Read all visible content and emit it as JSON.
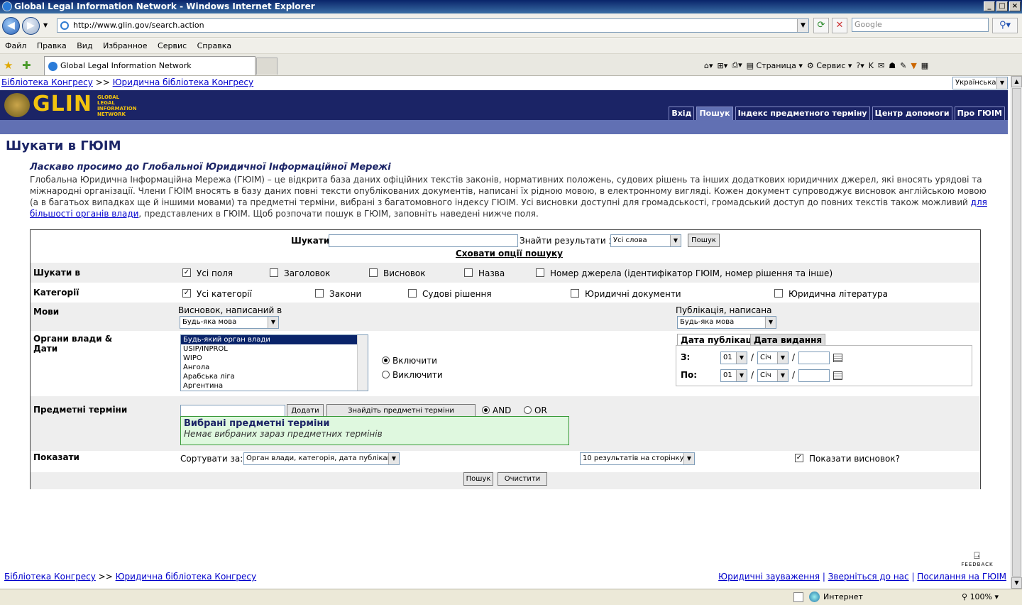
{
  "window": {
    "title": "Global Legal Information Network - Windows Internet Explorer"
  },
  "browser": {
    "url": "http://www.glin.gov/search.action",
    "search_placeholder": "Google",
    "menu": [
      "Файл",
      "Правка",
      "Вид",
      "Избранное",
      "Сервис",
      "Справка"
    ],
    "tab_title": "Global Legal Information Network",
    "cmd_page": "Страница",
    "cmd_tools": "Сервис",
    "status_zone": "Интернет",
    "zoom": "100%"
  },
  "page": {
    "breadcrumb": {
      "item1": "Бібліотека Конгресу",
      "sep": ">>",
      "item2": "Юридична бібліотека Конгресу"
    },
    "language_select": "Українська",
    "logo": {
      "text": "GLIN",
      "sub1": "GLOBAL",
      "sub2": "LEGAL",
      "sub3": "INFORMATION",
      "sub4": "NETWORK"
    },
    "nav": [
      "Вхід",
      "Пошук",
      "Індекс предметного терміну",
      "Центр допомоги",
      "Про ГЮІМ"
    ],
    "heading": "Шукати в ГЮІМ",
    "welcome_title": "Ласкаво просимо до Глобальної Юридичної Інформаційної Мережі",
    "intro": "Глобальна Юридична Інформаційна Мережа (ГЮІМ) – це відкрита база даних офіційних текстів законів, нормативних положень, судових рішень та інших додаткових юридичних джерел, які вносять урядові та міжнародні організації. Члени ГЮІМ вносять в базу даних повні тексти опублікованих документів, написані їх рідною мовою, в електронному вигляді. Кожен документ супроводжує висновок англійською мовою (а в багатьох випадках ще й іншими мовами) та предметні терміни, вибрані з багатомовного індексу ГЮІМ. Усі висновки доступні для громадськості, громадський доступ до повних текстів також можливий ",
    "intro_link": "для більшості органів влади",
    "intro_end": ", представлених в ГЮІМ. Щоб розпочати пошук в ГЮІМ, заповніть наведені нижче поля.",
    "footer_links": [
      "Юридичні зауваження",
      "Зверніться до нас",
      "Посилання на ГЮІМ"
    ],
    "feedback": "FEEDBACK"
  },
  "form": {
    "search_label": "Шукати",
    "find_results_label": "Знайти результати з",
    "find_results_value": "Усі слова",
    "search_button": "Пошук",
    "hide_options": "Сховати опції пошуку",
    "search_in": {
      "label": "Шукати в",
      "options": [
        "Усі поля",
        "Заголовок",
        "Висновок",
        "Назва",
        "Номер джерела (ідентифікатор ГЮІМ, номер рішення та інше)"
      ],
      "checked": [
        true,
        false,
        false,
        false,
        false
      ]
    },
    "categories": {
      "label": "Категорії",
      "options": [
        "Усі категорії",
        "Закони",
        "Судові рішення",
        "Юридичні документи",
        "Юридична література"
      ],
      "checked": [
        true,
        false,
        false,
        false,
        false
      ]
    },
    "languages": {
      "label": "Мови",
      "summary_label": "Висновок, написаний в",
      "summary_value": "Будь-яка мова",
      "pub_label": "Публікація, написана",
      "pub_value": "Будь-яка мова"
    },
    "jurisdictions": {
      "label1": "Органи влади &",
      "label2": "Дати",
      "list": [
        "Будь-який орган влади",
        "USIP/INPROL",
        "WIPO",
        "Ангола",
        "Арабська ліга",
        "Аргентина"
      ],
      "include": "Включити",
      "exclude": "Виключити"
    },
    "dates": {
      "tab_pub": "Дата публікації",
      "tab_issue": "Дата видання",
      "from": "З:",
      "to": "По:",
      "day": "01",
      "month": "Січ",
      "sep": "/"
    },
    "subjects": {
      "label": "Предметні терміни",
      "add": "Додати",
      "find": "Знайдіть предметні терміни",
      "and": "AND",
      "or": "OR",
      "selected_title": "Вибрані предметні терміни",
      "selected_empty": "Немає вибраних зараз предметних термінів"
    },
    "display": {
      "label": "Показати",
      "sort_label": "Сортувати за:",
      "sort_value": "Орган влади, категорія, дата публікації",
      "per_page": "10 результатів на сторінку",
      "show_summary": "Показати висновок?"
    },
    "submit": "Пошук",
    "clear": "Очистити"
  }
}
